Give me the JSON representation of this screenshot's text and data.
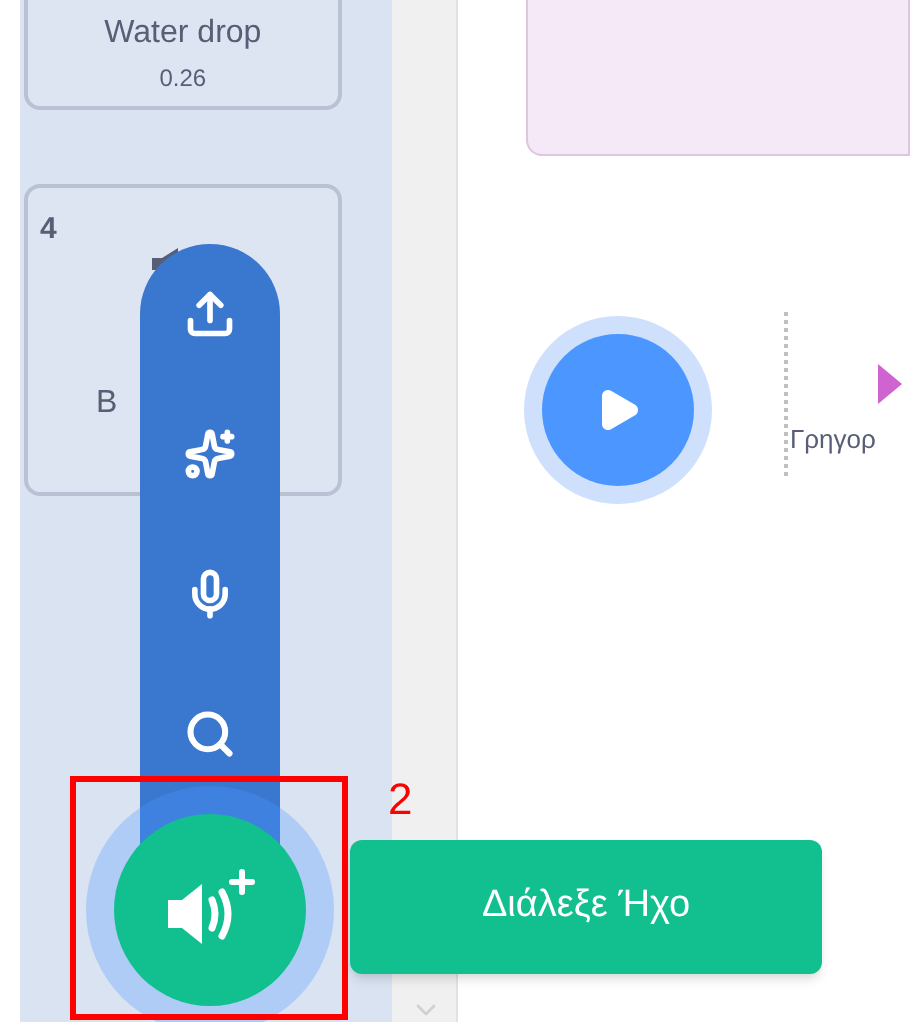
{
  "sounds": [
    {
      "name": "Water drop",
      "duration": "0.26"
    },
    {
      "number": "4",
      "name": "B"
    }
  ],
  "sound_menu": {
    "items": [
      {
        "kind": "upload"
      },
      {
        "kind": "surprise"
      },
      {
        "kind": "record"
      },
      {
        "kind": "search"
      }
    ],
    "tooltip": "Διάλεξε Ήχο"
  },
  "annotation": {
    "label": "2"
  },
  "editor": {
    "effect_label": "Γρηγορ"
  }
}
